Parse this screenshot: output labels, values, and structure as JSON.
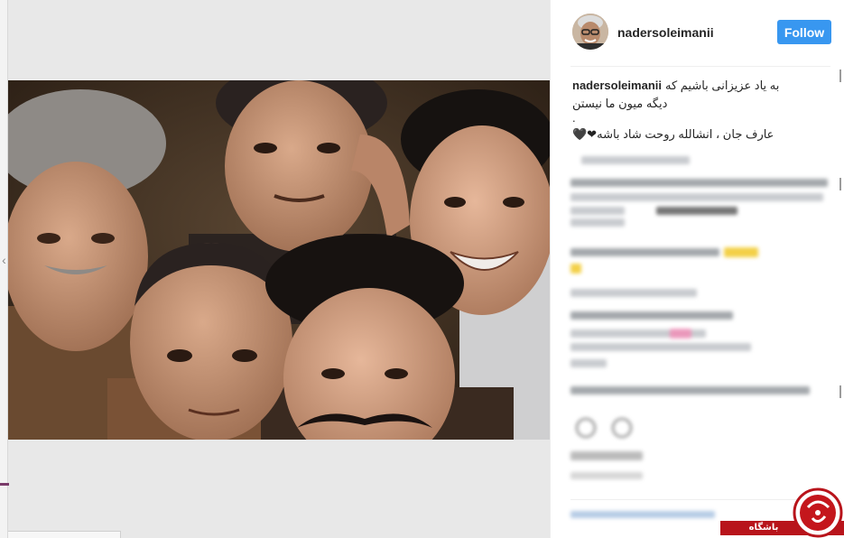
{
  "post": {
    "username": "nadersoleimanii",
    "follow_label": "Follow",
    "caption": {
      "line1": "به یاد عزیزانی باشیم که",
      "line2": "دیگه میون ما نیستن",
      "line3": ".",
      "line4": "عارف جان ، انشالله روحت شاد باشه",
      "hearts": "❤🖤"
    }
  },
  "watermark": {
    "text": "باشگاه خبرنگاران"
  },
  "navigation": {
    "left_arrow": "‹"
  },
  "colors": {
    "follow_button": "#3897f0",
    "watermark_red": "#b8141b",
    "heart_pink": "#e8457f"
  }
}
